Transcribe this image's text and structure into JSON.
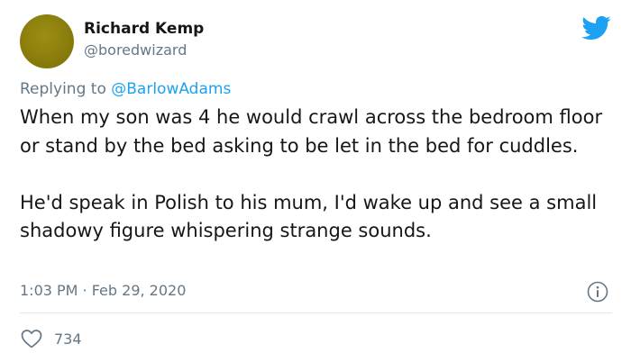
{
  "author": {
    "display_name": "Richard Kemp",
    "handle": "@boredwizard",
    "avatar_color": "#8a7d0c"
  },
  "reply": {
    "prefix": "Replying to ",
    "mention": "@BarlowAdams"
  },
  "body": {
    "paragraphs": [
      "When my son was 4 he would crawl across the bedroom floor or stand by the bed asking to be let in the bed for cuddles.",
      "He'd speak in Polish to his mum, I'd wake up and see a small shadowy figure whispering strange sounds."
    ]
  },
  "meta": {
    "timestamp": "1:03 PM · Feb 29, 2020"
  },
  "stats": {
    "likes": "734"
  },
  "icons": {
    "brand": "twitter-bird-icon",
    "info": "info-icon",
    "like": "heart-icon"
  },
  "colors": {
    "brand_blue": "#1da1f2",
    "secondary_text": "#657786",
    "divider": "#e1e8ed"
  }
}
